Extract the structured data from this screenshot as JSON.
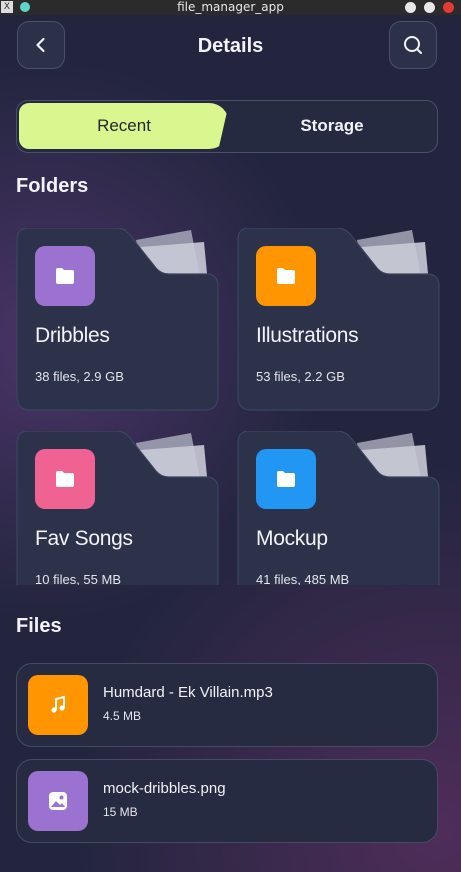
{
  "window": {
    "title": "file_manager_app"
  },
  "header": {
    "title": "Details",
    "back_icon": "chevron-left-icon",
    "search_icon": "search-icon"
  },
  "tabs": [
    {
      "label": "Recent",
      "active": true
    },
    {
      "label": "Storage",
      "active": false
    }
  ],
  "colors": {
    "accent": "#d9f68f",
    "purple": "#9b72cf",
    "orange": "#ff9500",
    "pink": "#f06292",
    "blue": "#2196f3"
  },
  "folders_section": {
    "title": "Folders",
    "items": [
      {
        "name": "Dribbles",
        "meta": "38 files, 2.9 GB",
        "color": "#9b72cf",
        "icon": "folder-icon"
      },
      {
        "name": "Illustrations",
        "meta": "53 files, 2.2 GB",
        "color": "#ff9500",
        "icon": "folder-icon"
      },
      {
        "name": "Fav Songs",
        "meta": "10 files, 55 MB",
        "color": "#f06292",
        "icon": "folder-icon"
      },
      {
        "name": "Mockup",
        "meta": "41 files, 485 MB",
        "color": "#2196f3",
        "icon": "folder-icon"
      }
    ]
  },
  "files_section": {
    "title": "Files",
    "items": [
      {
        "name": "Humdard - Ek Villain.mp3",
        "size": "4.5 MB",
        "color": "#ff9500",
        "icon": "music-note-icon"
      },
      {
        "name": "mock-dribbles.png",
        "size": "15 MB",
        "color": "#9b72cf",
        "icon": "image-icon"
      }
    ]
  }
}
